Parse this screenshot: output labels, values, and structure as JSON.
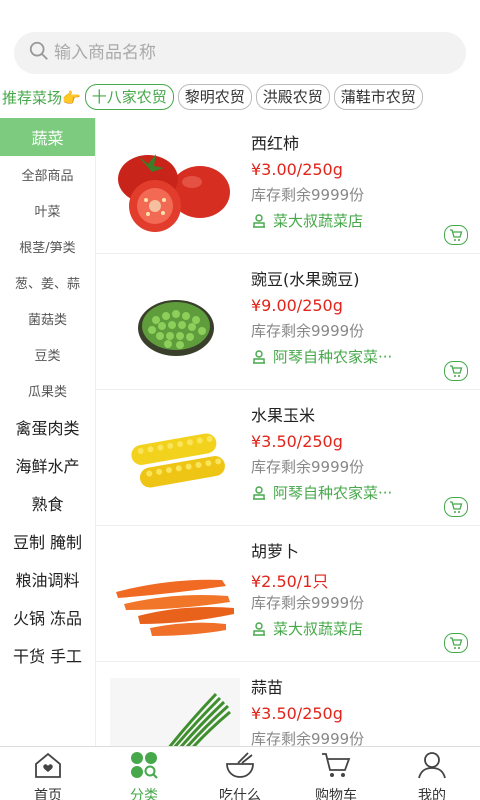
{
  "search": {
    "placeholder": "输入商品名称"
  },
  "markets": {
    "recommend_label": "推荐菜场",
    "recommend_icon": "pointing-hand-icon",
    "chips": [
      {
        "label": "十八家农贸",
        "active": true
      },
      {
        "label": "黎明农贸",
        "active": false
      },
      {
        "label": "洪殿农贸",
        "active": false
      },
      {
        "label": "蒲鞋市农贸",
        "active": false
      }
    ]
  },
  "sidebar": {
    "items": [
      {
        "label": "蔬菜",
        "state": "active"
      },
      {
        "label": "全部商品",
        "state": "sub"
      },
      {
        "label": "叶菜",
        "state": "sub"
      },
      {
        "label": "根茎/笋类",
        "state": "sub"
      },
      {
        "label": "葱、姜、蒜",
        "state": "sub"
      },
      {
        "label": "菌菇类",
        "state": "sub"
      },
      {
        "label": "豆类",
        "state": "sub"
      },
      {
        "label": "瓜果类",
        "state": "sub"
      },
      {
        "label": "禽蛋肉类",
        "state": "main"
      },
      {
        "label": "海鲜水产",
        "state": "main"
      },
      {
        "label": "熟食",
        "state": "main"
      },
      {
        "label": "豆制 腌制",
        "state": "main"
      },
      {
        "label": "粮油调料",
        "state": "main"
      },
      {
        "label": "火锅 冻品",
        "state": "main"
      },
      {
        "label": "干货 手工",
        "state": "main"
      }
    ]
  },
  "products": [
    {
      "name": "西红柿",
      "price": "¥3.00/250g",
      "stock": "库存剩余9999份",
      "shop": "菜大叔蔬菜店",
      "image": "tomato"
    },
    {
      "name": "豌豆(水果豌豆)",
      "price": "¥9.00/250g",
      "stock": "库存剩余9999份",
      "shop": "阿琴自种农家菜···",
      "image": "peas"
    },
    {
      "name": "水果玉米",
      "price": "¥3.50/250g",
      "stock": "库存剩余9999份",
      "shop": "阿琴自种农家菜···",
      "image": "corn"
    },
    {
      "name": "胡萝卜",
      "price": "¥2.50/1只",
      "stock": "库存剩余9999份",
      "shop": "菜大叔蔬菜店",
      "image": "carrot"
    },
    {
      "name": "蒜苗",
      "price": "¥3.50/250g",
      "stock": "库存剩余9999份",
      "shop": "",
      "image": "garlic-sprout"
    }
  ],
  "tabbar": {
    "items": [
      {
        "label": "首页",
        "icon": "home-icon",
        "active": false
      },
      {
        "label": "分类",
        "icon": "category-icon",
        "active": true
      },
      {
        "label": "吃什么",
        "icon": "bowl-icon",
        "active": false
      },
      {
        "label": "购物车",
        "icon": "cart-icon",
        "active": false
      },
      {
        "label": "我的",
        "icon": "user-icon",
        "active": false
      }
    ]
  },
  "colors": {
    "accent": "#46a84a",
    "price": "#e2231a",
    "sidebar_active": "#7ccb7f"
  }
}
